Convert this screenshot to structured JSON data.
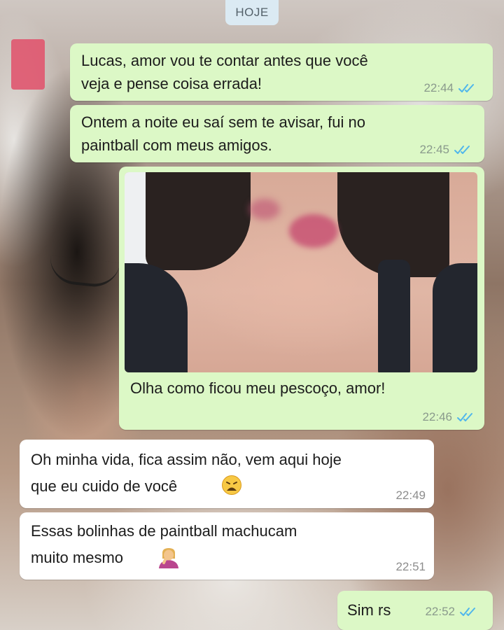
{
  "chat": {
    "date_label": "HOJE",
    "messages": [
      {
        "from": "me",
        "text": "Lucas, amor vou te contar antes que você\nveja e pense coisa errada!",
        "time": "22:44",
        "status": "read"
      },
      {
        "from": "me",
        "text": "Ontem a noite eu saí sem te avisar, fui no\npaintball com meus amigos.",
        "time": "22:45",
        "status": "read"
      },
      {
        "from": "me",
        "type": "image",
        "caption": "Olha como ficou meu pescoço, amor!",
        "time": "22:46",
        "status": "read"
      },
      {
        "from": "them",
        "text": "Oh minha vida, fica assim não, vem aqui hoje\nque eu cuido de você",
        "emoji": "weary-face",
        "time": "22:49"
      },
      {
        "from": "them",
        "text": "Essas bolinhas de paintball machucam\nmuito mesmo",
        "emoji": "person-facepalming",
        "time": "22:51"
      },
      {
        "from": "me",
        "text": "Sim rs",
        "time": "22:52",
        "status": "read"
      }
    ]
  },
  "colors": {
    "outgoing_bubble": "#dcf8c6",
    "incoming_bubble": "#ffffff",
    "read_ticks": "#4fb6ec",
    "date_pill": "#dbeaf3"
  }
}
